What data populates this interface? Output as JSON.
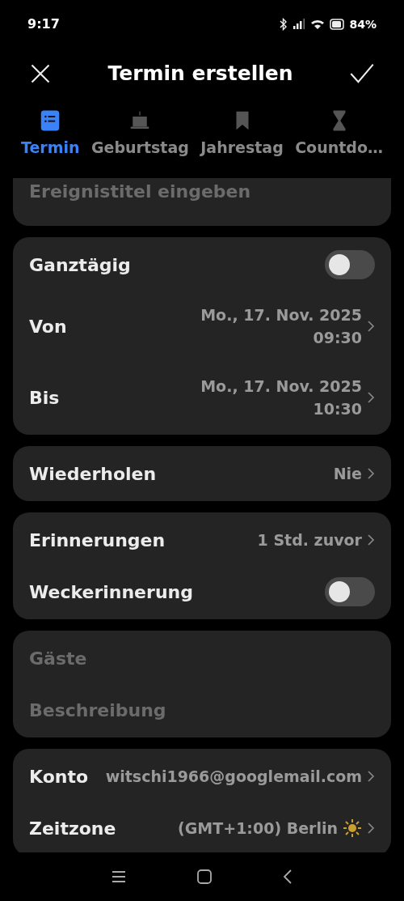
{
  "status_bar": {
    "time": "9:17",
    "battery": "84%"
  },
  "header": {
    "title": "Termin erstellen"
  },
  "tabs": [
    {
      "label": "Termin",
      "selected": true
    },
    {
      "label": "Geburtstag",
      "selected": false
    },
    {
      "label": "Jahrestag",
      "selected": false
    },
    {
      "label": "Countdo…",
      "selected": false
    }
  ],
  "title_field": {
    "placeholder": "Ereignistitel eingeben"
  },
  "cards": [
    {
      "rows": [
        {
          "kind": "toggle",
          "label": "Ganztägig",
          "on": false
        },
        {
          "kind": "datetime",
          "label": "Von",
          "date": "Mo., 17. Nov. 2025",
          "time": "09:30"
        },
        {
          "kind": "datetime",
          "label": "Bis",
          "date": "Mo., 17. Nov. 2025",
          "time": "10:30"
        }
      ]
    },
    {
      "rows": [
        {
          "kind": "value",
          "label": "Wiederholen",
          "value": "Nie"
        }
      ]
    },
    {
      "rows": [
        {
          "kind": "value",
          "label": "Erinnerungen",
          "value": "1 Std. zuvor"
        },
        {
          "kind": "toggle",
          "label": "Weckerinnerung",
          "on": false
        }
      ]
    },
    {
      "rows": [
        {
          "kind": "placeholder",
          "label": "Gäste"
        },
        {
          "kind": "placeholder",
          "label": "Beschreibung"
        }
      ]
    },
    {
      "rows": [
        {
          "kind": "value",
          "label": "Konto",
          "value": "witschi1966@googlemail.com"
        },
        {
          "kind": "timezone",
          "label": "Zeitzone",
          "value": "(GMT+1:00) Berlin"
        }
      ]
    }
  ]
}
